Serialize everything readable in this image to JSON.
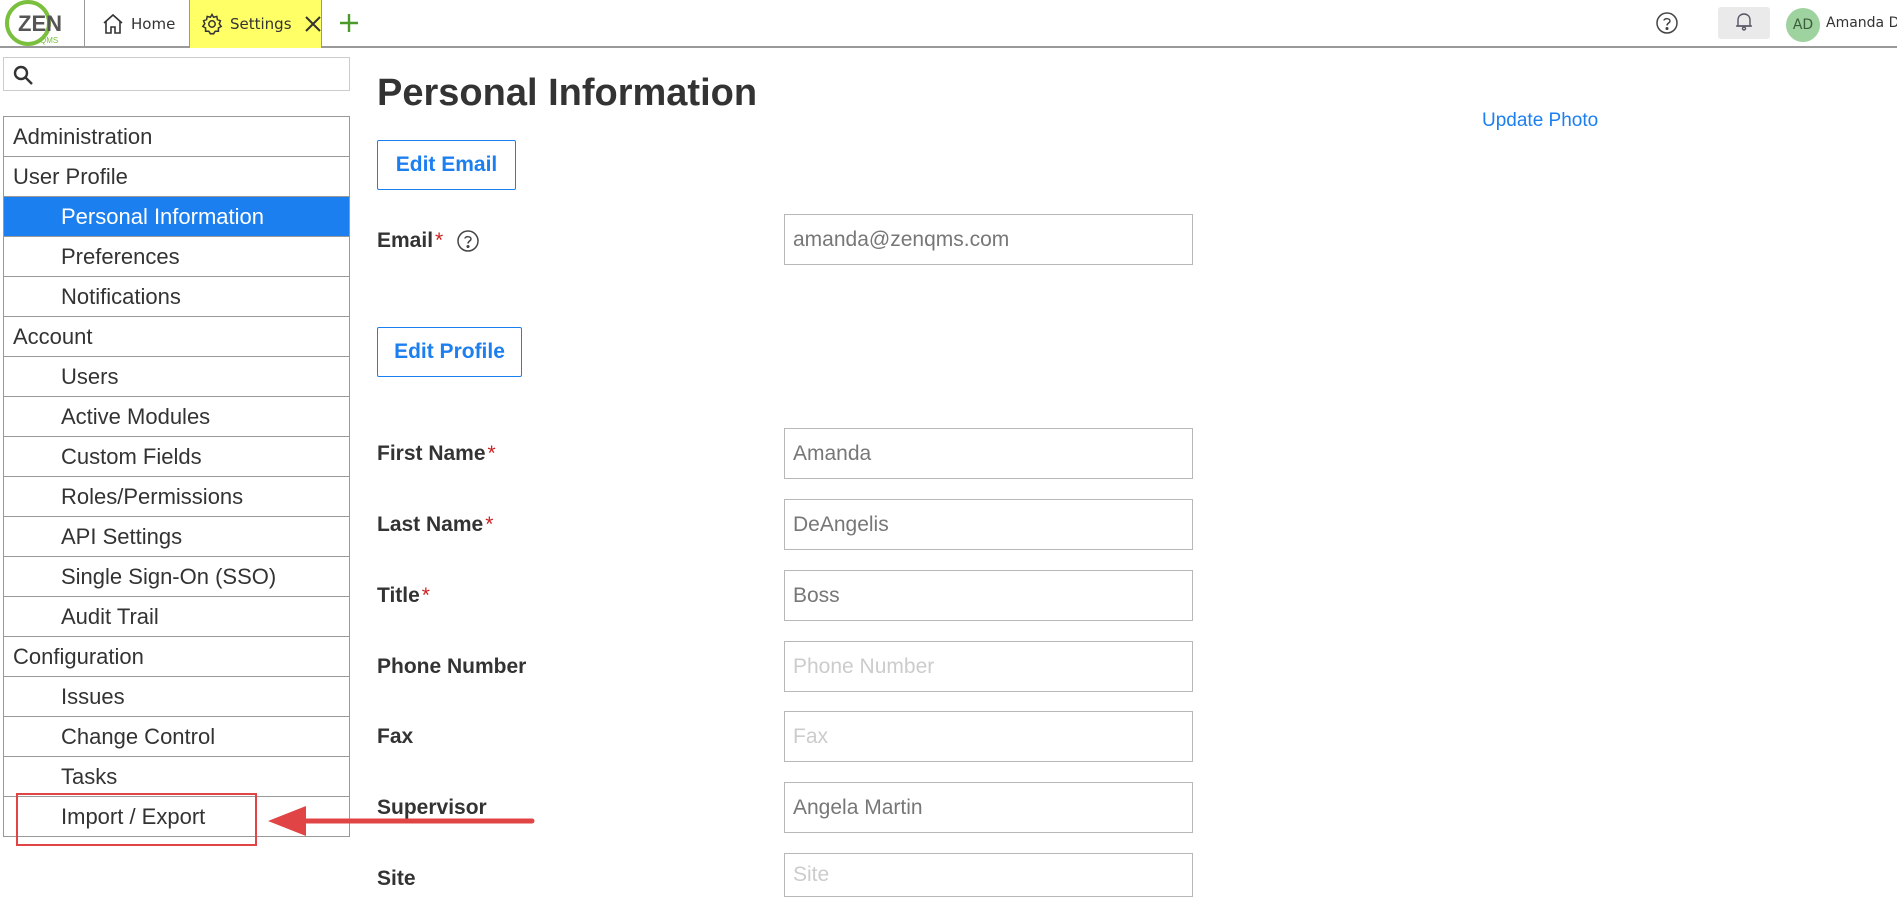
{
  "header": {
    "logo_text": "ZEN",
    "logo_subtext": "QMS",
    "tabs": [
      {
        "label": "Home"
      },
      {
        "label": "Settings"
      }
    ],
    "avatar_initials": "AD",
    "user_name": "Amanda D"
  },
  "sidebar": {
    "search_placeholder": "",
    "items": [
      {
        "label": "Administration"
      },
      {
        "label": "User Profile"
      },
      {
        "label": "Personal Information"
      },
      {
        "label": "Preferences"
      },
      {
        "label": "Notifications"
      },
      {
        "label": "Account"
      },
      {
        "label": "Users"
      },
      {
        "label": "Active Modules"
      },
      {
        "label": "Custom Fields"
      },
      {
        "label": "Roles/Permissions"
      },
      {
        "label": "API Settings"
      },
      {
        "label": "Single Sign-On (SSO)"
      },
      {
        "label": "Audit Trail"
      },
      {
        "label": "Configuration"
      },
      {
        "label": "Issues"
      },
      {
        "label": "Change Control"
      },
      {
        "label": "Tasks"
      },
      {
        "label": "Import / Export"
      }
    ]
  },
  "main": {
    "title": "Personal Information",
    "update_photo": "Update Photo",
    "edit_email_button": "Edit Email",
    "edit_profile_button": "Edit Profile",
    "email": {
      "label": "Email",
      "value": "amanda@zenqms.com"
    },
    "first_name": {
      "label": "First Name",
      "value": "Amanda"
    },
    "last_name": {
      "label": "Last Name",
      "value": "DeAngelis"
    },
    "title_field": {
      "label": "Title",
      "value": "Boss"
    },
    "phone": {
      "label": "Phone Number",
      "placeholder": "Phone Number"
    },
    "fax": {
      "label": "Fax",
      "placeholder": "Fax"
    },
    "supervisor": {
      "label": "Supervisor",
      "value": "Angela Martin"
    },
    "site": {
      "label": "Site",
      "placeholder": "Site"
    },
    "required_mark": "*"
  },
  "colors": {
    "accent": "#1c7ff0",
    "active_tab": "#ffff66",
    "annotation": "#e04444",
    "required": "#cc2222"
  }
}
